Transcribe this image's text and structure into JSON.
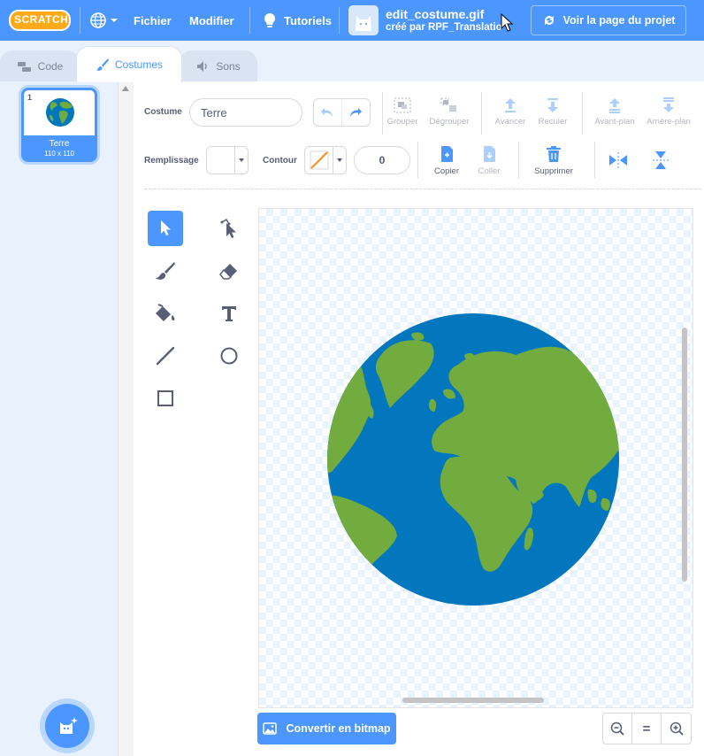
{
  "menu": {
    "logo": "SCRATCH",
    "file": "Fichier",
    "edit": "Modifier",
    "tutorials": "Tutoriels",
    "project_title": "edit_costume.gif",
    "author": "créé par RPF_Translatio",
    "see_project": "Voir la page du projet",
    "icons": [
      "globe-icon",
      "bulb-icon",
      "project-thumb-icon",
      "see-project-icon"
    ]
  },
  "tabs": {
    "code": "Code",
    "costumes": "Costumes",
    "sounds": "Sons"
  },
  "costume_list": [
    {
      "index": "1",
      "name": "Terre",
      "size": "110 x 110",
      "selected": true
    }
  ],
  "editor": {
    "costume_label": "Costume",
    "costume_name": "Terre",
    "group": "Grouper",
    "ungroup": "Dégrouper",
    "forward": "Avancer",
    "backward": "Reculer",
    "front": "Avant-plan",
    "back": "Arrière-plan",
    "fill_label": "Remplissage",
    "outline_label": "Contour",
    "outline_width": "0",
    "copy": "Copier",
    "paste": "Coller",
    "delete": "Supprimer",
    "convert": "Convertir en bitmap",
    "zoom_reset": "="
  },
  "colors": {
    "accent": "#4c97ff",
    "ocean": "#0277bd",
    "land": "#72ab3e",
    "outline_swatch": "#ff8c1a"
  },
  "tools": [
    "select",
    "reshape",
    "brush",
    "eraser",
    "fill",
    "text",
    "line",
    "circle",
    "rectangle"
  ]
}
